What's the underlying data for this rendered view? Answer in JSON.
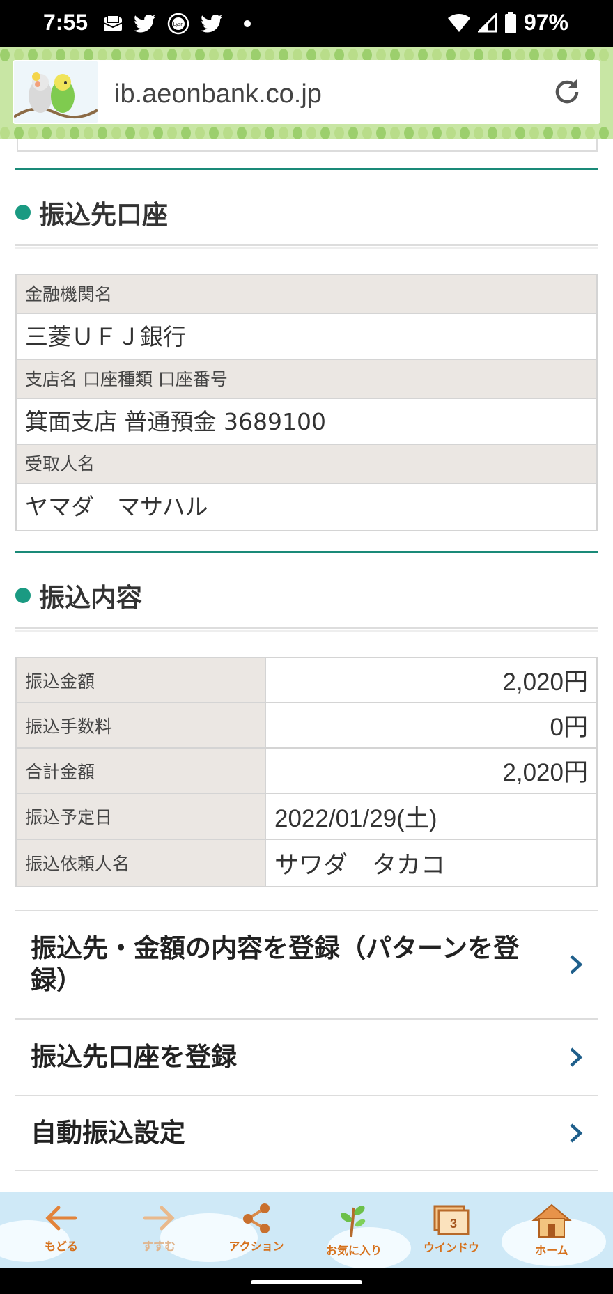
{
  "status_bar": {
    "time": "7:55",
    "battery": "97%",
    "icons": [
      "mail-icon",
      "twitter-icon",
      "lysn-icon",
      "twitter-icon",
      "dot-icon",
      "wifi-icon",
      "signal-icon",
      "battery-icon"
    ],
    "lysn_text": "Lysn"
  },
  "browser": {
    "url": "ib.aeonbank.co.jp"
  },
  "payee_section": {
    "title": "振込先口座",
    "rows": [
      {
        "label": "金融機関名",
        "value": "三菱ＵＦＪ銀行"
      },
      {
        "label": "支店名 口座種類 口座番号",
        "value": "箕面支店 普通預金 3689100"
      },
      {
        "label": "受取人名",
        "value": "ヤマダ　マサハル"
      }
    ]
  },
  "transfer_section": {
    "title": "振込内容",
    "rows": [
      {
        "label": "振込金額",
        "value": "2,020円"
      },
      {
        "label": "振込手数料",
        "value": "0円"
      },
      {
        "label": "合計金額",
        "value": "2,020円"
      },
      {
        "label": "振込予定日",
        "value": "2022/01/29(土)"
      },
      {
        "label": "振込依頼人名",
        "value": "サワダ　タカコ"
      }
    ]
  },
  "links": [
    {
      "label": "振込先・金額の内容を登録（パターンを登録）"
    },
    {
      "label": "振込先口座を登録"
    },
    {
      "label": "自動振込設定"
    }
  ],
  "toolbar": {
    "items": [
      {
        "label": "もどる",
        "icon": "back-arrow-icon"
      },
      {
        "label": "すすむ",
        "icon": "forward-arrow-icon"
      },
      {
        "label": "アクション",
        "icon": "share-icon"
      },
      {
        "label": "お気に入り",
        "icon": "sprout-icon"
      },
      {
        "label": "ウインドウ",
        "icon": "window-icon",
        "badge": "3"
      },
      {
        "label": "ホーム",
        "icon": "house-icon"
      }
    ]
  },
  "colors": {
    "accent": "#1a8a78",
    "toolbar_label": "#d6711c",
    "link_chevron": "#1f5f8b"
  }
}
